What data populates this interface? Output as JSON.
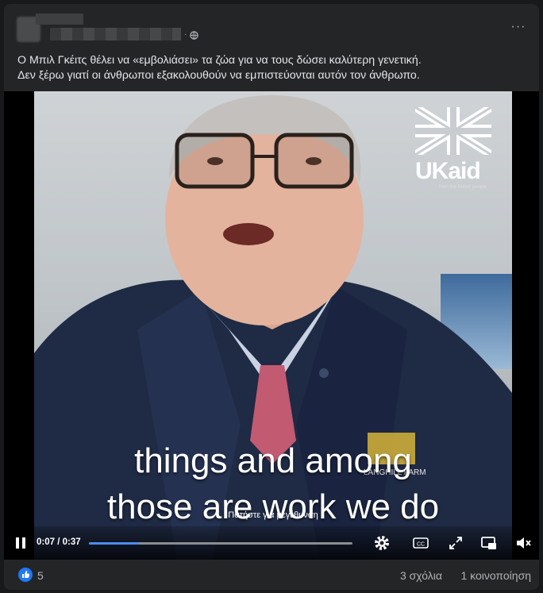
{
  "post": {
    "caption_line1": "Ο Μπιλ Γκέιτς θέλει να «εμβολιάσει» τα ζώα για να τους δώσει καλύτερη γενετική.",
    "caption_line2": "Δεν ξέρω γιατί οι άνθρωποι εξακολουθούν να εμπιστεύονται αυτόν τον άνθρωπο.",
    "more_label": "···",
    "separator": "·"
  },
  "video": {
    "logo_text": "UKaid",
    "logo_sub": "from the British people",
    "jacket_text": "LANGHILL FARM",
    "subtitle_line1": "things and among",
    "subtitle_line2": "those are work we do",
    "hint": "Πατήστε για μεγέθυνση",
    "time": "0:07 / 0:37",
    "progress": 0.19
  },
  "footer": {
    "like_count": "5",
    "comments": "3 σχόλια",
    "shares": "1 κοινοποίηση"
  },
  "colors": {
    "accent": "#4c8cf5",
    "like": "#2078f4"
  },
  "icons": [
    "globe-icon",
    "more-icon",
    "pause-icon",
    "settings-icon",
    "captions-icon",
    "fullscreen-icon",
    "picture-in-picture-icon",
    "volume-muted-icon",
    "like-icon"
  ]
}
